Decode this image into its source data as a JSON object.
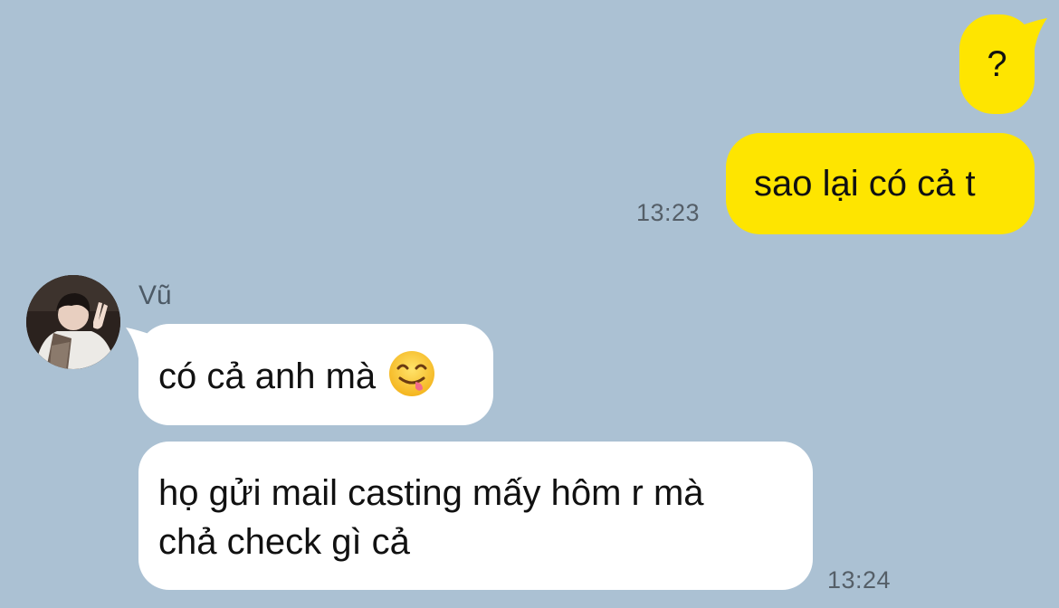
{
  "messages": [
    {
      "direction": "outgoing",
      "text": "?"
    },
    {
      "direction": "outgoing",
      "text": "sao lại có cả t",
      "time": "13:23"
    },
    {
      "direction": "incoming",
      "text": "có cả anh mà",
      "emoji": "yum-face-emoji"
    },
    {
      "direction": "incoming",
      "lines": [
        "họ gửi mail casting mấy hôm r mà",
        "chả check gì cả"
      ],
      "time": "13:24"
    }
  ],
  "sender": {
    "name": "Vũ",
    "avatar": "profile-photo"
  },
  "colors": {
    "background": "#abc1d3",
    "outgoing_bubble": "#fee500",
    "incoming_bubble": "#ffffff",
    "timestamp": "#555f68"
  }
}
